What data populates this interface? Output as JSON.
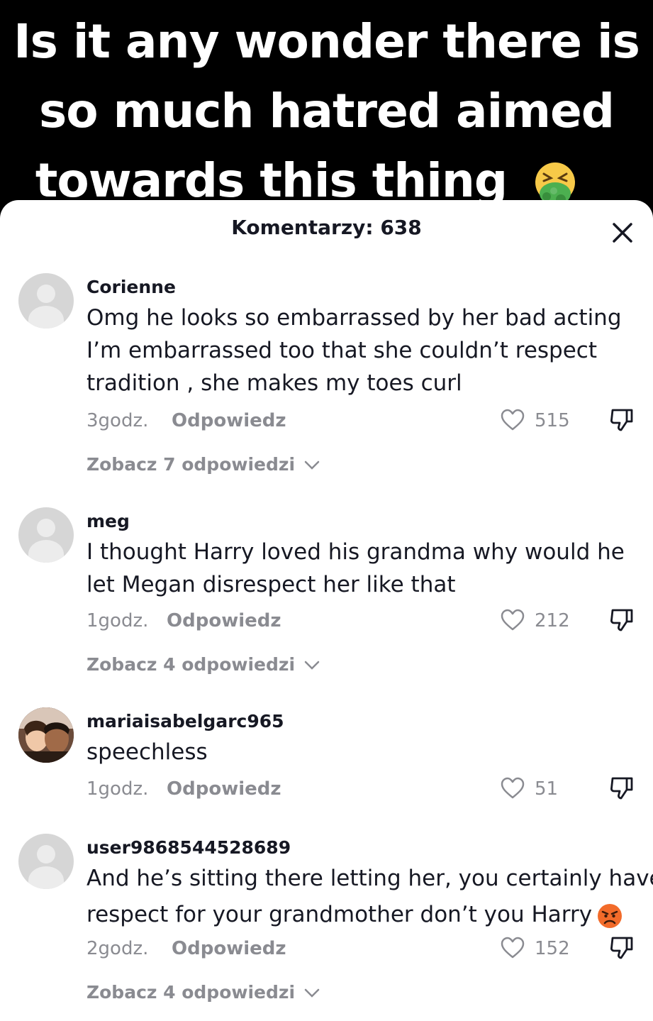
{
  "caption": {
    "lines": [
      "Is it any wonder there is",
      "so much hatred aimed",
      "towards this thing"
    ],
    "emoji": "nauseated-face-emoji"
  },
  "sheet": {
    "title": "Komentarzy: 638",
    "close_icon": "close-icon"
  },
  "comments": [
    {
      "username": "Corienne",
      "lines": [
        "Omg he looks so embarrassed by her bad acting",
        "I’m embarrassed too that she couldn’t respect",
        "tradition , she makes my toes curl"
      ],
      "time": "3godz.",
      "reply_label": "Odpowiedz",
      "likes": "515",
      "view_replies": "Zobacz 7 odpowiedzi"
    },
    {
      "username": "meg",
      "lines": [
        "I thought Harry loved his grandma why would he",
        "let Megan disrespect her like that"
      ],
      "time": "1godz.",
      "reply_label": "Odpowiedz",
      "likes": "212",
      "view_replies": "Zobacz 4 odpowiedzi"
    },
    {
      "username": "mariaisabelgarc965",
      "lines": [
        "speechless"
      ],
      "time": "1godz.",
      "reply_label": "Odpowiedz",
      "likes": "51",
      "view_replies": ""
    },
    {
      "username": "user9868544528689",
      "lines": [
        "And he’s sitting there letting her, you certainly have",
        "respect for your grandmother don’t you Harry"
      ],
      "emoji": "angry-face-emoji",
      "time": "2godz.",
      "reply_label": "Odpowiedz",
      "likes": "152",
      "view_replies": "Zobacz 4 odpowiedzi"
    }
  ],
  "colors": {
    "text_primary": "#161823",
    "text_secondary": "#8a8b91",
    "avatar_placeholder": "#d6d6d6"
  }
}
